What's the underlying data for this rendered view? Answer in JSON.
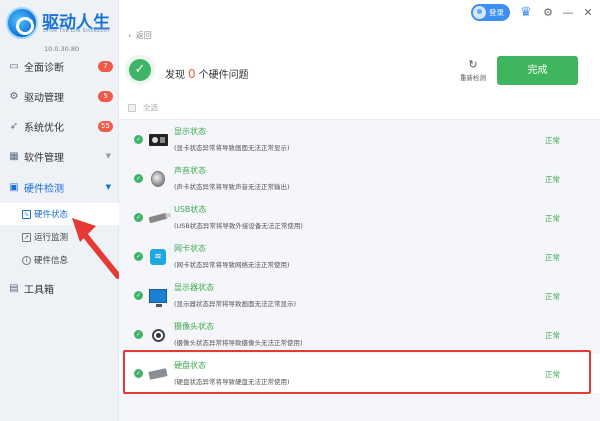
{
  "brand": {
    "title": "驱动人生",
    "subtitle": "Drive The Life Since2007",
    "version": "10.0.30.80"
  },
  "sidebar": {
    "items": [
      {
        "label": "全面诊断",
        "badge": "7",
        "icon": "monitor-icon"
      },
      {
        "label": "驱动管理",
        "badge": "5",
        "icon": "gear-icon"
      },
      {
        "label": "系统优化",
        "badge": "55",
        "icon": "rocket-icon"
      },
      {
        "label": "软件管理",
        "badge": "",
        "icon": "grid-icon"
      },
      {
        "label": "硬件检测",
        "badge": "",
        "icon": "chip-icon"
      },
      {
        "label": "工具箱",
        "badge": "",
        "icon": "toolbox-icon"
      }
    ],
    "sub_items": [
      {
        "label": "硬件状态",
        "icon": "pulse-icon"
      },
      {
        "label": "运行监测",
        "icon": "chart-icon"
      },
      {
        "label": "硬件信息",
        "icon": "info-icon"
      }
    ]
  },
  "header": {
    "login_label": "登录",
    "back_label": "返回"
  },
  "summary": {
    "prefix": "发现",
    "count": "0",
    "suffix": "个硬件问题",
    "rescan_label": "重新检测",
    "done_label": "完成"
  },
  "select_all_label": "全选",
  "devices": [
    {
      "title": "显示状态",
      "desc": "(显卡状态异常将导致画面无法正常显示)",
      "status": "正常",
      "icon": "gpu-icon"
    },
    {
      "title": "声音状态",
      "desc": "(声卡状态异常将导致声音无法正常输出)",
      "status": "正常",
      "icon": "speaker-icon"
    },
    {
      "title": "USB状态",
      "desc": "(USB状态异常将导致外接设备无法正常使用)",
      "status": "正常",
      "icon": "usb-icon"
    },
    {
      "title": "网卡状态",
      "desc": "(网卡状态异常将导致网络无法正常使用)",
      "status": "正常",
      "icon": "wifi-icon"
    },
    {
      "title": "显示器状态",
      "desc": "(显示器状态异常将导致画面无法正常显示)",
      "status": "正常",
      "icon": "monitor-icon"
    },
    {
      "title": "摄像头状态",
      "desc": "(摄像头状态异常将导致摄像头无法正常使用)",
      "status": "正常",
      "icon": "webcam-icon"
    },
    {
      "title": "硬盘状态",
      "desc": "(硬盘状态异常将导致硬盘无法正常使用)",
      "status": "正常",
      "icon": "disk-icon"
    }
  ],
  "colors": {
    "accent": "#1a6fd6",
    "success": "#3fb55d",
    "badge": "#f05a4a",
    "highlight": "#e53935"
  }
}
